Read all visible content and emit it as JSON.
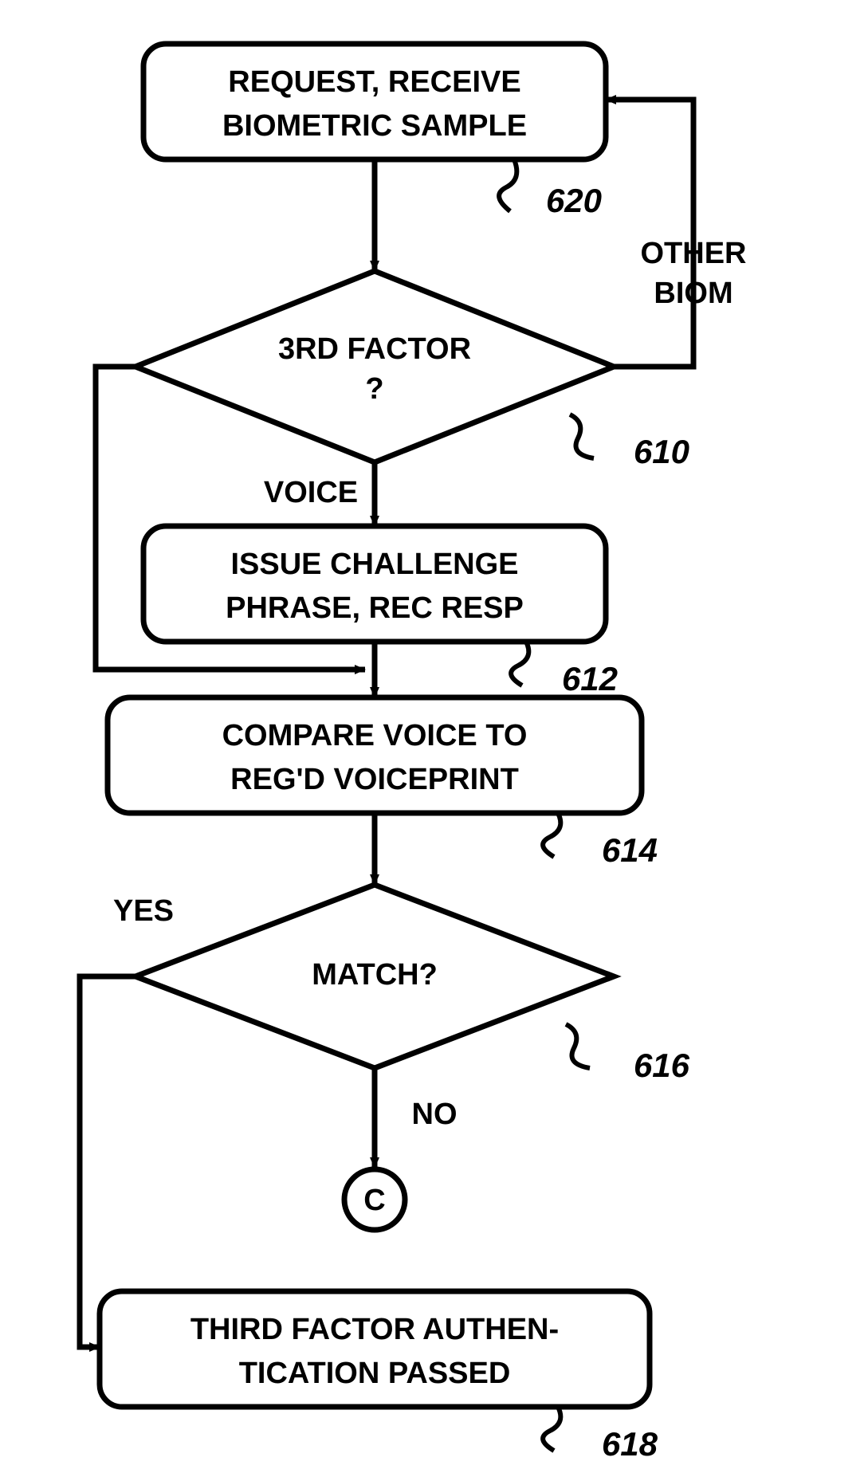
{
  "boxes": {
    "b620": {
      "line1": "REQUEST, RECEIVE",
      "line2": "BIOMETRIC SAMPLE",
      "ref": "620"
    },
    "d610": {
      "line1": "3RD FACTOR",
      "line2": "?",
      "ref": "610"
    },
    "b612": {
      "line1": "ISSUE CHALLENGE",
      "line2": "PHRASE, REC RESP",
      "ref": "612"
    },
    "b614": {
      "line1": "COMPARE VOICE TO",
      "line2": "REG'D VOICEPRINT",
      "ref": "614"
    },
    "d616": {
      "line1": "MATCH?",
      "ref": "616"
    },
    "b618": {
      "line1": "THIRD FACTOR AUTHEN-",
      "line2": "TICATION PASSED",
      "ref": "618"
    }
  },
  "labels": {
    "otherBiom1": "OTHER",
    "otherBiom2": "BIOM",
    "voice": "VOICE",
    "yes": "YES",
    "no": "NO",
    "connector": "C"
  }
}
